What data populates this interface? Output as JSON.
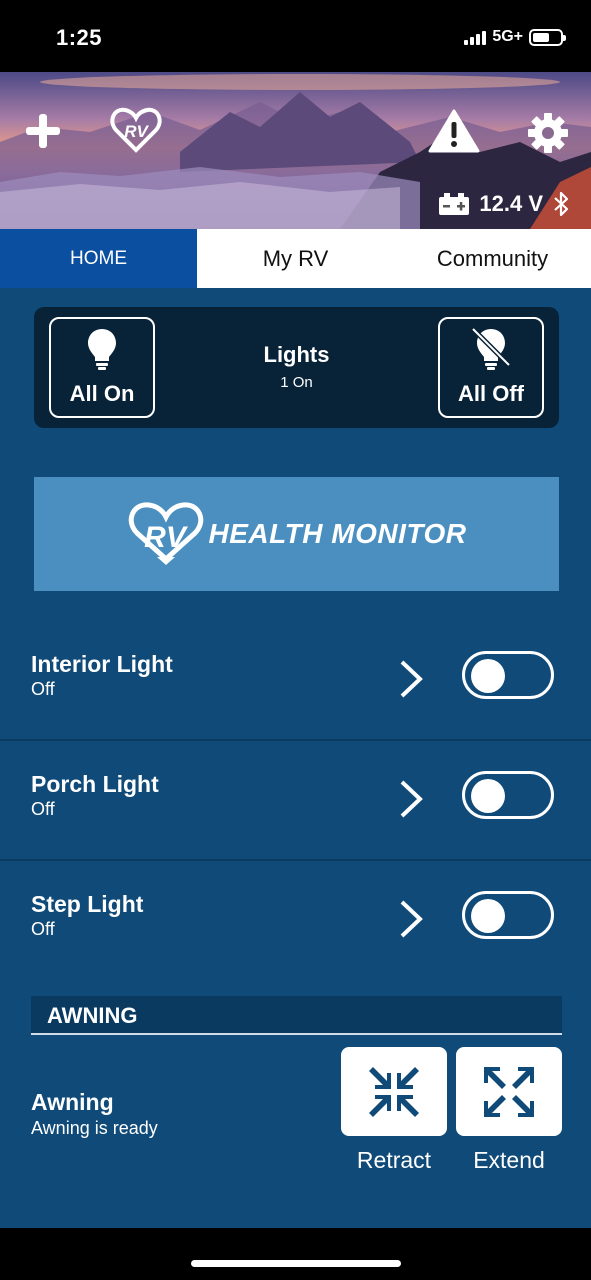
{
  "status_bar": {
    "time": "1:25",
    "network": "5G+"
  },
  "header": {
    "voltage": "12.4 V"
  },
  "tabs": [
    {
      "label": "HOME",
      "active": true
    },
    {
      "label": "My RV",
      "active": false
    },
    {
      "label": "Community",
      "active": false
    }
  ],
  "lights": {
    "title": "Lights",
    "count": "1 On",
    "all_on_label": "All On",
    "all_off_label": "All Off"
  },
  "banner": {
    "logo_text": "RV",
    "title": "HEALTH MONITOR"
  },
  "devices": [
    {
      "name": "Interior Light",
      "status": "Off",
      "on": false
    },
    {
      "name": "Porch Light",
      "status": "Off",
      "on": false
    },
    {
      "name": "Step Light",
      "status": "Off",
      "on": false
    }
  ],
  "awning": {
    "section_title": "AWNING",
    "name": "Awning",
    "status": "Awning is ready",
    "retract_label": "Retract",
    "extend_label": "Extend"
  },
  "colors": {
    "primary_bg": "#0f4a78",
    "card_bg": "#082237",
    "active_tab": "#0a4fa0",
    "banner_bg": "#4a8fc0"
  },
  "icons": [
    "plus-icon",
    "rv-heart-logo-icon",
    "warning-icon",
    "gear-icon",
    "battery-icon",
    "bluetooth-icon",
    "bulb-on-icon",
    "bulb-off-icon",
    "chevron-right-icon",
    "retract-arrows-icon",
    "extend-arrows-icon"
  ]
}
